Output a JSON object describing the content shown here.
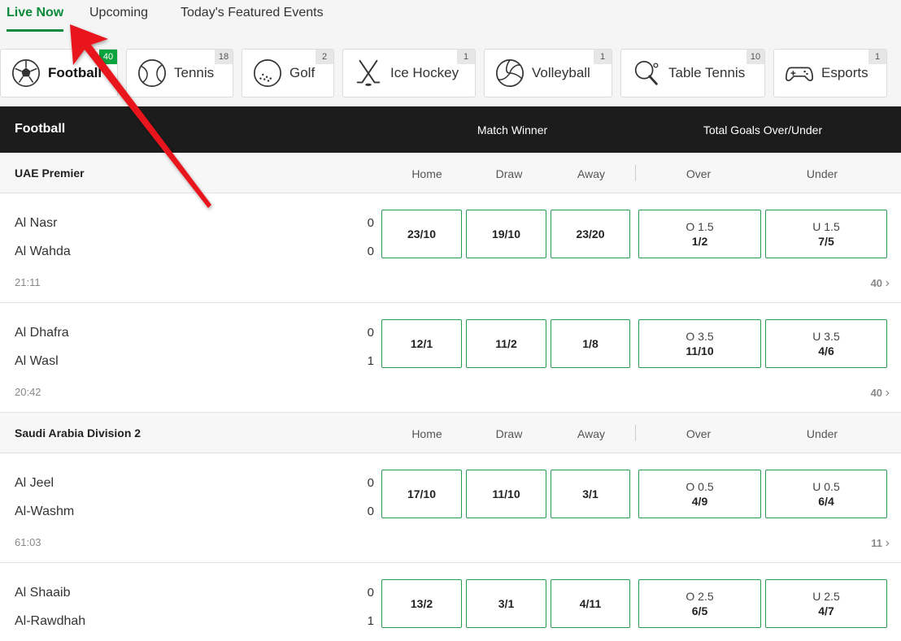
{
  "tabs": [
    {
      "label": "Live Now",
      "active": true
    },
    {
      "label": "Upcoming",
      "active": false
    },
    {
      "label": "Today's Featured Events",
      "active": false
    }
  ],
  "sports": [
    {
      "label": "Football",
      "count": "40",
      "icon": "football-icon",
      "active": true
    },
    {
      "label": "Tennis",
      "count": "18",
      "icon": "tennis-icon"
    },
    {
      "label": "Golf",
      "count": "2",
      "icon": "golf-icon"
    },
    {
      "label": "Ice Hockey",
      "count": "1",
      "icon": "ice-hockey-icon"
    },
    {
      "label": "Volleyball",
      "count": "1",
      "icon": "volleyball-icon"
    },
    {
      "label": "Table Tennis",
      "count": "10",
      "icon": "table-tennis-icon"
    },
    {
      "label": "Esports",
      "count": "1",
      "icon": "esports-icon"
    }
  ],
  "header": {
    "sport": "Football",
    "market1": "Match Winner",
    "market2": "Total Goals Over/Under"
  },
  "columns": {
    "home": "Home",
    "draw": "Draw",
    "away": "Away",
    "over": "Over",
    "under": "Under"
  },
  "leagues": [
    {
      "name": "UAE Premier",
      "matches": [
        {
          "home": "Al Nasr",
          "away": "Al Wahda",
          "home_score": "0",
          "away_score": "0",
          "time": "21:11",
          "odds_home": "23/10",
          "odds_draw": "19/10",
          "odds_away": "23/20",
          "over_line": "O 1.5",
          "over_odds": "1/2",
          "under_line": "U 1.5",
          "under_odds": "7/5",
          "markets": "40"
        },
        {
          "home": "Al Dhafra",
          "away": "Al Wasl",
          "home_score": "0",
          "away_score": "1",
          "time": "20:42",
          "odds_home": "12/1",
          "odds_draw": "11/2",
          "odds_away": "1/8",
          "over_line": "O 3.5",
          "over_odds": "11/10",
          "under_line": "U 3.5",
          "under_odds": "4/6",
          "markets": "40"
        }
      ]
    },
    {
      "name": "Saudi Arabia Division 2",
      "matches": [
        {
          "home": "Al Jeel",
          "away": "Al-Washm",
          "home_score": "0",
          "away_score": "0",
          "time": "61:03",
          "odds_home": "17/10",
          "odds_draw": "11/10",
          "odds_away": "3/1",
          "over_line": "O 0.5",
          "over_odds": "4/9",
          "under_line": "U 0.5",
          "under_odds": "6/4",
          "markets": "11"
        },
        {
          "home": "Al Shaaib",
          "away": "Al-Rawdhah",
          "home_score": "0",
          "away_score": "1",
          "time": "",
          "odds_home": "13/2",
          "odds_draw": "3/1",
          "odds_away": "4/11",
          "over_line": "O 2.5",
          "over_odds": "6/5",
          "under_line": "U 2.5",
          "under_odds": "4/7",
          "markets": ""
        }
      ]
    }
  ],
  "colors": {
    "accent": "#0a8a3a",
    "badge": "#0aa33e",
    "header_bg": "#1c1c1c",
    "annotation_arrow": "#e8141c"
  }
}
